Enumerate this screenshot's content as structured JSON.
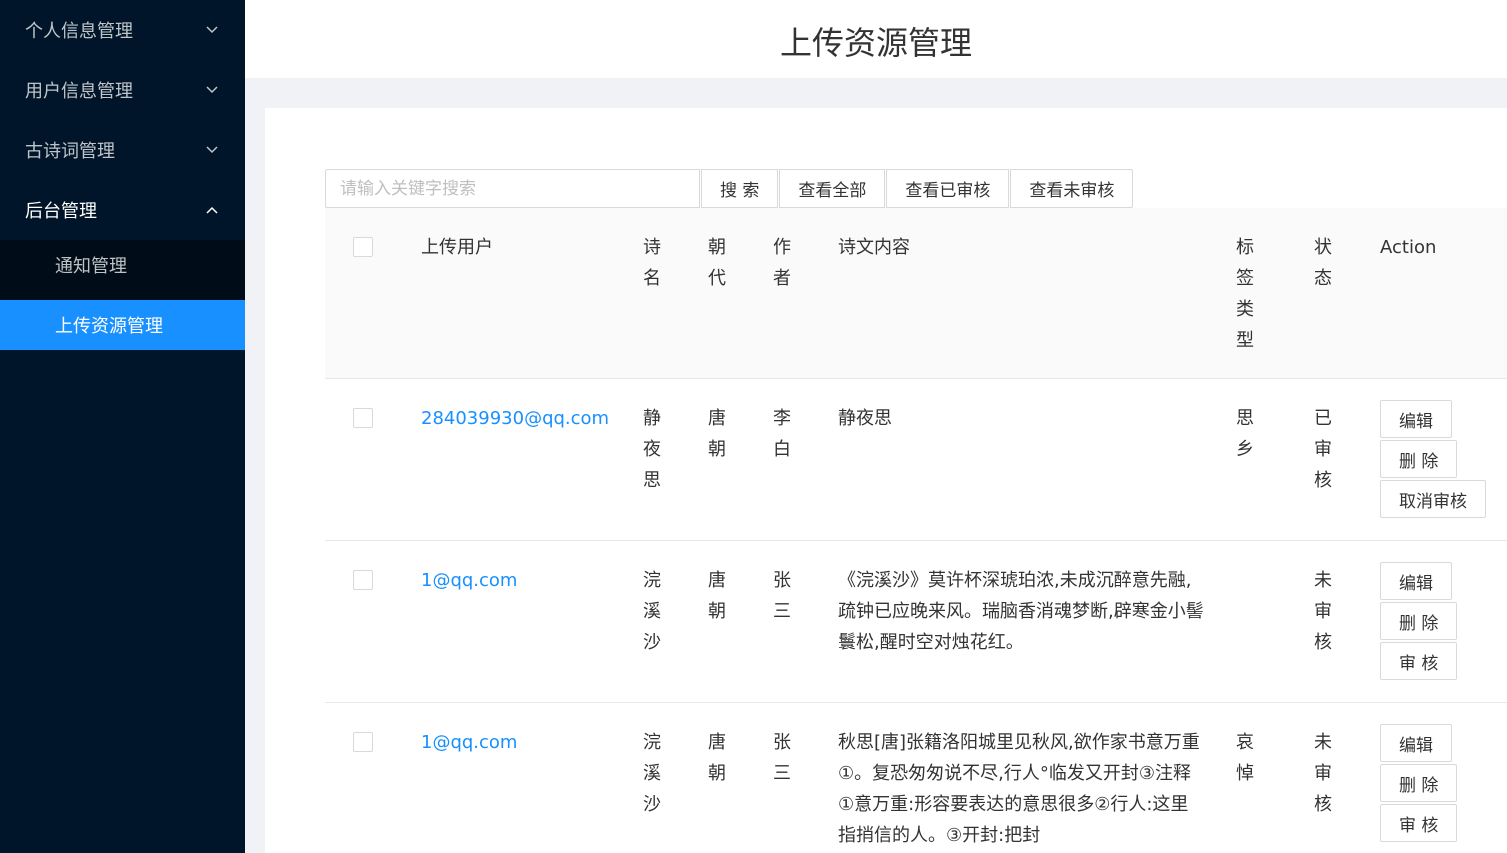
{
  "sidebar": {
    "items": [
      {
        "label": "个人信息管理",
        "icon": "chevron-down-icon"
      },
      {
        "label": "用户信息管理",
        "icon": "chevron-down-icon"
      },
      {
        "label": "古诗词管理",
        "icon": "chevron-down-icon"
      },
      {
        "label": "后台管理",
        "icon": "chevron-up-icon"
      }
    ],
    "submenu": [
      {
        "label": "通知管理"
      },
      {
        "label": "上传资源管理"
      }
    ]
  },
  "header": {
    "title": "上传资源管理"
  },
  "toolbar": {
    "search_placeholder": "请输入关键字搜索",
    "search_label": "搜 索",
    "all_label": "查看全部",
    "approved_label": "查看已审核",
    "unapproved_label": "查看未审核"
  },
  "table": {
    "headers": {
      "user": "上传用户",
      "poem": "诗名",
      "dynasty": "朝代",
      "author": "作者",
      "content": "诗文内容",
      "tag": "标签类型",
      "status": "状态",
      "action": "Action"
    },
    "rows": [
      {
        "user": "284039930@qq.com",
        "poem": "静夜思",
        "dynasty": "唐朝",
        "author": "李白",
        "content": "静夜思",
        "tag": "思乡",
        "status": "已审核",
        "actions": [
          "编辑",
          "删 除",
          "取消审核"
        ]
      },
      {
        "user": "1@qq.com",
        "poem": "浣溪沙",
        "dynasty": "唐朝",
        "author": "张三",
        "content": "《浣溪沙》莫许杯深琥珀浓,未成沉醉意先融,疏钟已应晚来风。瑞脑香消魂梦断,辟寒金小髻鬟松,醒时空对烛花红。",
        "tag": "",
        "status": "未审核",
        "actions": [
          "编辑",
          "删 除",
          "审 核"
        ]
      },
      {
        "user": "1@qq.com",
        "poem": "浣溪沙",
        "dynasty": "唐朝",
        "author": "张三",
        "content": "秋思[唐]张籍洛阳城里见秋风,欲作家书意万重①。复恐匆匆说不尽,行人°临发又开封③注释①意万重:形容要表达的意思很多②行人:这里指捎信的人。③开封:把封",
        "tag": "哀悼",
        "status": "未审核",
        "actions": [
          "编辑",
          "删 除",
          "审 核"
        ]
      }
    ]
  }
}
